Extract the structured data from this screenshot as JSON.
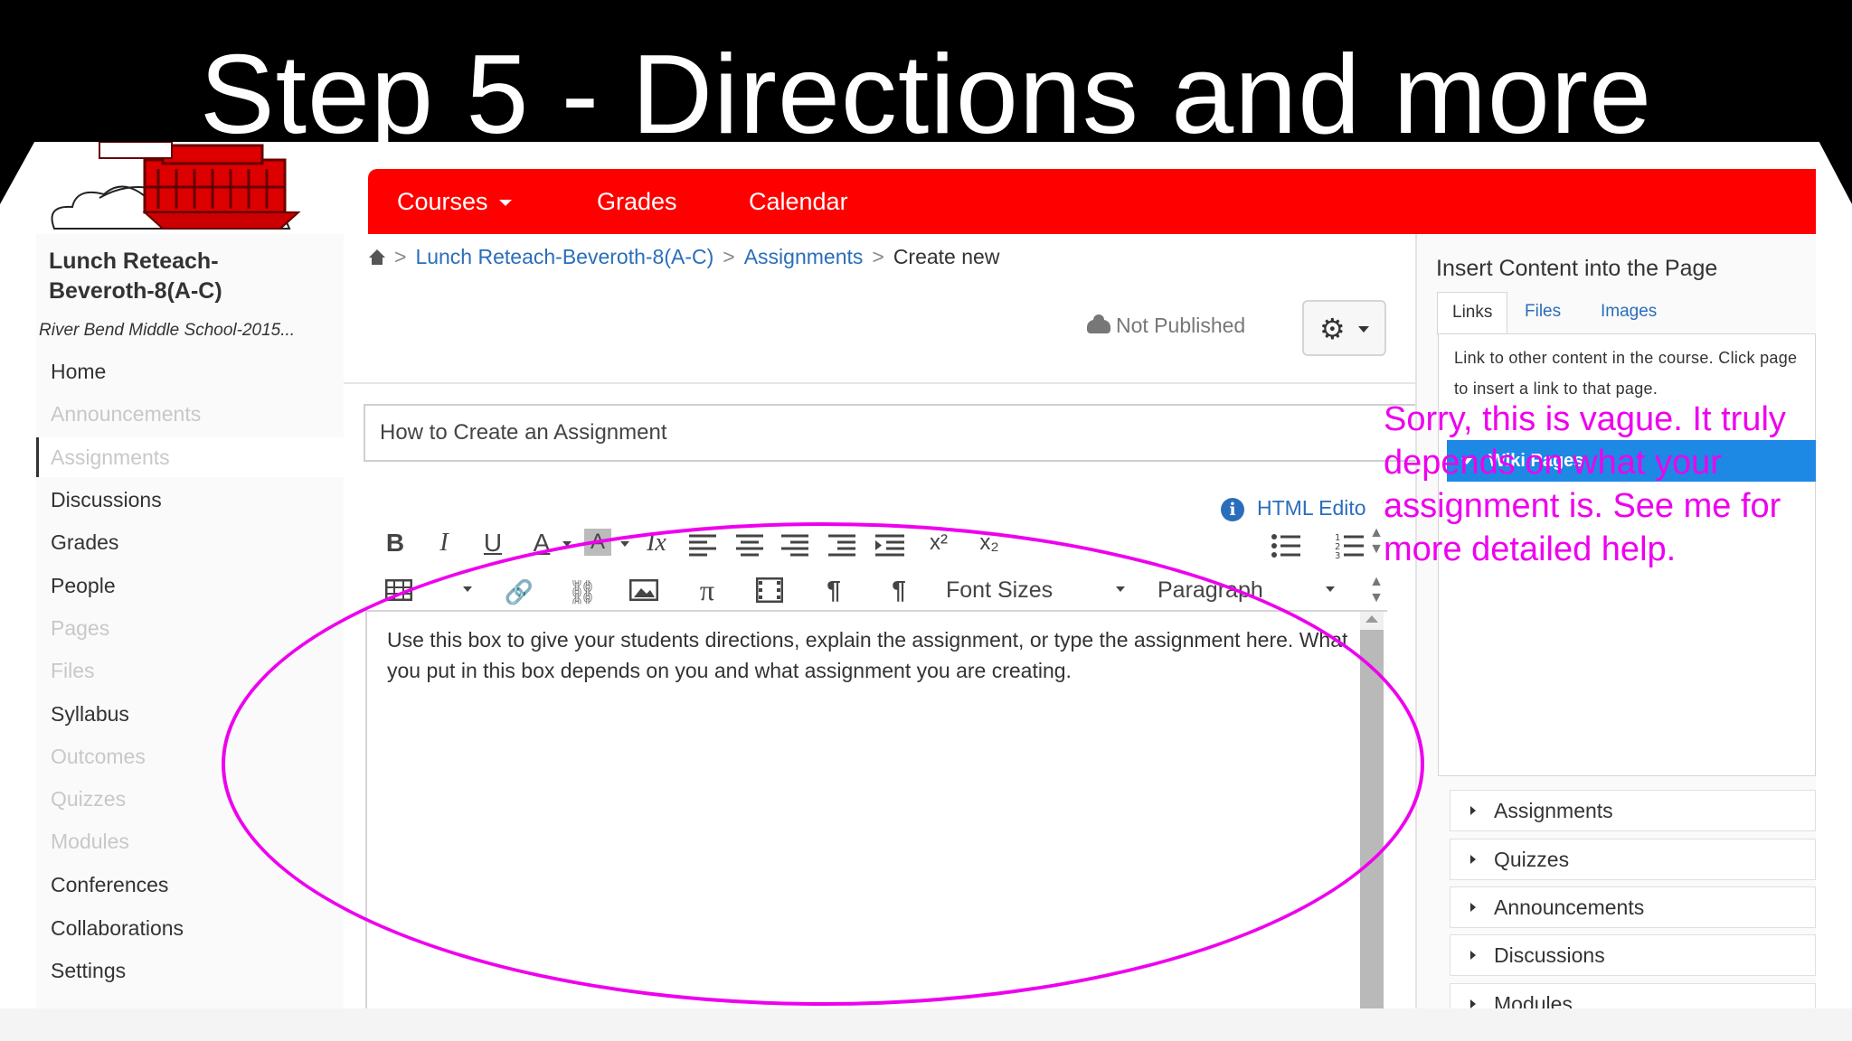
{
  "slide": {
    "title": "Step 5 - Directions and more"
  },
  "nav": {
    "items": [
      {
        "label": "Courses"
      },
      {
        "label": "Grades"
      },
      {
        "label": "Calendar"
      }
    ]
  },
  "sidebar": {
    "course_title": "Lunch Reteach-Beveroth-8(A-C)",
    "school": "River Bend Middle School-2015...",
    "items": [
      {
        "label": "Home"
      },
      {
        "label": "Announcements"
      },
      {
        "label": "Assignments"
      },
      {
        "label": "Discussions"
      },
      {
        "label": "Grades"
      },
      {
        "label": "People"
      },
      {
        "label": "Pages"
      },
      {
        "label": "Files"
      },
      {
        "label": "Syllabus"
      },
      {
        "label": "Outcomes"
      },
      {
        "label": "Quizzes"
      },
      {
        "label": "Modules"
      },
      {
        "label": "Conferences"
      },
      {
        "label": "Collaborations"
      },
      {
        "label": "Settings"
      }
    ]
  },
  "breadcrumb": {
    "course": "Lunch Reteach-Beveroth-8(A-C)",
    "section": "Assignments",
    "current": "Create new"
  },
  "status": {
    "published": "Not Published"
  },
  "assignment": {
    "title_value": "How to Create an Assignment",
    "body": "Use this box to give your students directions, explain the assignment, or type the assignment here.  What you put in this box depends on you and what assignment you are creating."
  },
  "editor": {
    "html_editor_label": "HTML Edito",
    "font_sizes_label": "Font Sizes",
    "paragraph_label": "Paragraph",
    "bold_glyph": "B",
    "italic_glyph": "I",
    "underline_glyph": "U",
    "font_color_glyph": "A",
    "bg_color_glyph": "A",
    "clear_format_glyph": "Ix",
    "pi_glyph": "π",
    "pilcrow_glyph": "¶"
  },
  "right_panel": {
    "title": "Insert Content into the Page",
    "tabs": [
      {
        "label": "Links"
      },
      {
        "label": "Files"
      },
      {
        "label": "Images"
      }
    ],
    "description": "Link to other content in the course. Click page to insert a link to that page.",
    "wiki_pages": "Wiki Pages",
    "sections": [
      {
        "label": "Assignments"
      },
      {
        "label": "Quizzes"
      },
      {
        "label": "Announcements"
      },
      {
        "label": "Discussions"
      },
      {
        "label": "Modules"
      }
    ]
  },
  "annotation": {
    "note": "Sorry, this is vague. It truly depends on what your assignment is.  See me for more detailed help.",
    "color": "#ee00ee"
  },
  "colors": {
    "nav": "#ff0000",
    "link": "#2a6ebb",
    "wiki": "#1e88e5"
  }
}
